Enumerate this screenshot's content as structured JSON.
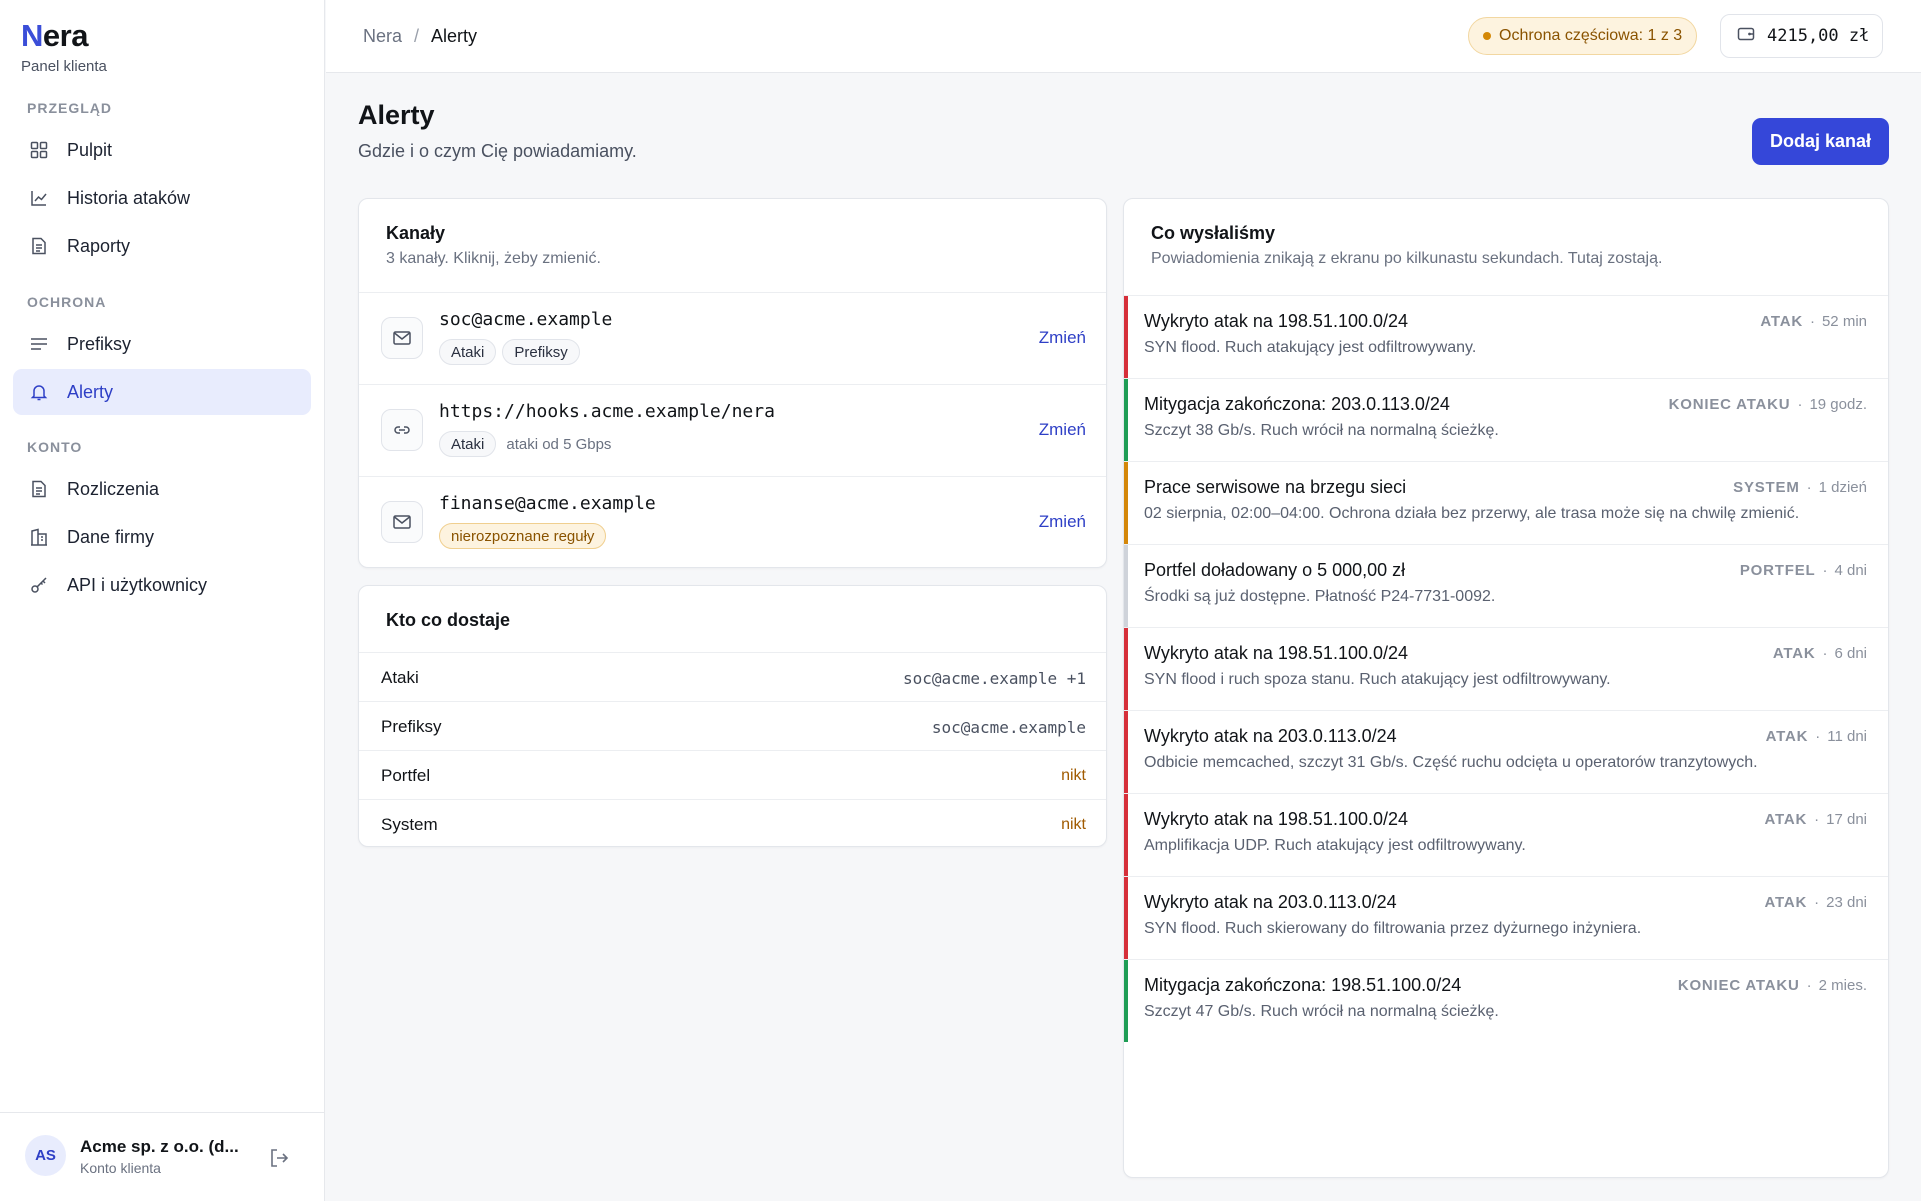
{
  "brand": {
    "logo_first": "N",
    "logo_rest": "era",
    "subtitle": "Panel klienta"
  },
  "colors": {
    "accent": "#3547d9",
    "attack": "#d62f3a",
    "end": "#1f9d55",
    "system": "#d4870a",
    "wallet": "#cfd3da"
  },
  "sidebar": {
    "sections": [
      {
        "label": "PRZEGLĄD",
        "items": [
          {
            "label": "Pulpit",
            "icon": "dashboard-icon"
          },
          {
            "label": "Historia ataków",
            "icon": "chart-line-icon"
          },
          {
            "label": "Raporty",
            "icon": "document-icon"
          }
        ]
      },
      {
        "label": "OCHRONA",
        "items": [
          {
            "label": "Prefiksy",
            "icon": "list-icon"
          },
          {
            "label": "Alerty",
            "icon": "bell-icon",
            "active": true
          }
        ]
      },
      {
        "label": "KONTO",
        "items": [
          {
            "label": "Rozliczenia",
            "icon": "document-icon"
          },
          {
            "label": "Dane firmy",
            "icon": "building-icon"
          },
          {
            "label": "API i użytkownicy",
            "icon": "key-icon"
          }
        ]
      }
    ],
    "account": {
      "initials": "AS",
      "name": "Acme sp. z o.o. (d...",
      "role": "Konto klienta"
    }
  },
  "topbar": {
    "breadcrumb": [
      "Nera",
      "Alerty"
    ],
    "breadcrumb_sep": "/",
    "protection_status": "Ochrona częściowa: 1 z 3",
    "balance": "4215,00 zł"
  },
  "page": {
    "title": "Alerty",
    "subtitle": "Gdzie i o czym Cię powiadamiamy.",
    "add_button": "Dodaj kanał"
  },
  "channels": {
    "title": "Kanały",
    "subtitle": "3 kanały. Kliknij, żeby zmienić.",
    "change_label": "Zmień",
    "items": [
      {
        "address": "soc@acme.example",
        "icon": "mail-icon",
        "tags": [
          "Ataki",
          "Prefiksy"
        ]
      },
      {
        "address": "https://hooks.acme.example/nera",
        "icon": "link-icon",
        "tags": [
          "Ataki"
        ],
        "note": "ataki od 5 Gbps"
      },
      {
        "address": "finanse@acme.example",
        "icon": "mail-icon",
        "warn_tag": "nierozpoznane reguły"
      }
    ]
  },
  "distribution": {
    "title": "Kto co dostaje",
    "rows": [
      {
        "label": "Ataki",
        "value": "soc@acme.example +1"
      },
      {
        "label": "Prefiksy",
        "value": "soc@acme.example"
      },
      {
        "label": "Portfel",
        "value": "nikt",
        "none": true
      },
      {
        "label": "System",
        "value": "nikt",
        "none": true
      }
    ]
  },
  "feed": {
    "title": "Co wysłaliśmy",
    "subtitle": "Powiadomienia znikają z ekranu po kilkunastu sekundach. Tutaj zostają.",
    "meta_sep": "·",
    "items": [
      {
        "title": "Wykryto atak na 198.51.100.0/24",
        "desc": "SYN flood. Ruch atakujący jest odfiltrowywany.",
        "kind": "ATAK",
        "time": "52 min",
        "color": "#d62f3a"
      },
      {
        "title": "Mitygacja zakończona: 203.0.113.0/24",
        "desc": "Szczyt 38 Gb/s. Ruch wrócił na normalną ścieżkę.",
        "kind": "KONIEC ATAKU",
        "time": "19 godz.",
        "color": "#1f9d55"
      },
      {
        "title": "Prace serwisowe na brzegu sieci",
        "desc": "02 sierpnia, 02:00–04:00. Ochrona działa bez przerwy, ale trasa może się na chwilę zmienić.",
        "kind": "SYSTEM",
        "time": "1 dzień",
        "color": "#d4870a"
      },
      {
        "title": "Portfel doładowany o 5 000,00 zł",
        "desc": "Środki są już dostępne. Płatność P24-7731-0092.",
        "kind": "PORTFEL",
        "time": "4 dni",
        "color": "#cfd3da"
      },
      {
        "title": "Wykryto atak na 198.51.100.0/24",
        "desc": "SYN flood i ruch spoza stanu. Ruch atakujący jest odfiltrowywany.",
        "kind": "ATAK",
        "time": "6 dni",
        "color": "#d62f3a"
      },
      {
        "title": "Wykryto atak na 203.0.113.0/24",
        "desc": "Odbicie memcached, szczyt 31 Gb/s. Część ruchu odcięta u operatorów tranzytowych.",
        "kind": "ATAK",
        "time": "11 dni",
        "color": "#d62f3a"
      },
      {
        "title": "Wykryto atak na 198.51.100.0/24",
        "desc": "Amplifikacja UDP. Ruch atakujący jest odfiltrowywany.",
        "kind": "ATAK",
        "time": "17 dni",
        "color": "#d62f3a"
      },
      {
        "title": "Wykryto atak na 203.0.113.0/24",
        "desc": "SYN flood. Ruch skierowany do filtrowania przez dyżurnego inżyniera.",
        "kind": "ATAK",
        "time": "23 dni",
        "color": "#d62f3a"
      },
      {
        "title": "Mitygacja zakończona: 198.51.100.0/24",
        "desc": "Szczyt 47 Gb/s. Ruch wrócił na normalną ścieżkę.",
        "kind": "KONIEC ATAKU",
        "time": "2 mies.",
        "color": "#1f9d55"
      }
    ]
  }
}
